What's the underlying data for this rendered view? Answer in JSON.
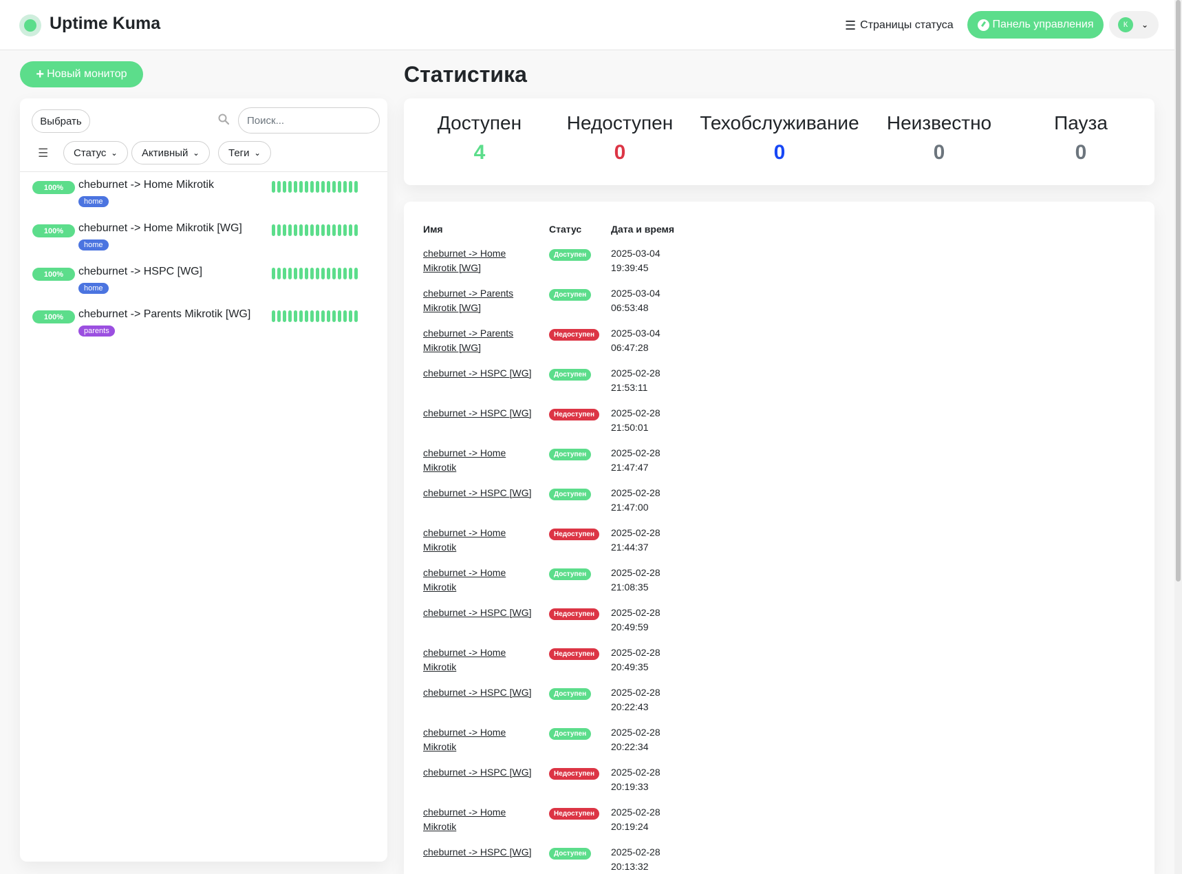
{
  "header": {
    "brand": "Uptime Kuma",
    "status_pages_label": "Страницы статуса",
    "dashboard_label": "Панель управления",
    "user_initial": "К"
  },
  "sidebar": {
    "new_monitor_label": "Новый монитор",
    "select_label": "Выбрать",
    "search_placeholder": "Поиск...",
    "filters": [
      "Статус",
      "Активный",
      "Теги"
    ],
    "monitors": [
      {
        "uptime": "100%",
        "name": "cheburnet -> Home Mikrotik",
        "tag": "home",
        "tag_color": "#4b74e0"
      },
      {
        "uptime": "100%",
        "name": "cheburnet -> Home Mikrotik [WG]",
        "tag": "home",
        "tag_color": "#4b74e0"
      },
      {
        "uptime": "100%",
        "name": "cheburnet -> HSPC [WG]",
        "tag": "home",
        "tag_color": "#4b74e0"
      },
      {
        "uptime": "100%",
        "name": "cheburnet -> Parents Mikrotik [WG]",
        "tag": "parents",
        "tag_color": "#9b4fe0"
      }
    ]
  },
  "main": {
    "title": "Статистика",
    "stats": [
      {
        "label": "Доступен",
        "value": "4",
        "color": "#5cdd8b"
      },
      {
        "label": "Недоступен",
        "value": "0",
        "color": "#dc3545"
      },
      {
        "label": "Техобслуживание",
        "value": "0",
        "color": "#1747f5"
      },
      {
        "label": "Неизвестно",
        "value": "0",
        "color": "#6c757d"
      },
      {
        "label": "Пауза",
        "value": "0",
        "color": "#6c757d"
      }
    ],
    "table_headers": {
      "name": "Имя",
      "status": "Статус",
      "datetime": "Дата и время"
    },
    "events": [
      {
        "name": "cheburnet -> Home Mikrotik [WG]",
        "status": "Доступен",
        "date": "2025-03-04 19:39:45"
      },
      {
        "name": "cheburnet -> Parents Mikrotik [WG]",
        "status": "Доступен",
        "date": "2025-03-04 06:53:48"
      },
      {
        "name": "cheburnet -> Parents Mikrotik [WG]",
        "status": "Недоступен",
        "date": "2025-03-04 06:47:28"
      },
      {
        "name": "cheburnet -> HSPC [WG]",
        "status": "Доступен",
        "date": "2025-02-28 21:53:11"
      },
      {
        "name": "cheburnet -> HSPC [WG]",
        "status": "Недоступен",
        "date": "2025-02-28 21:50:01"
      },
      {
        "name": "cheburnet -> Home Mikrotik",
        "status": "Доступен",
        "date": "2025-02-28 21:47:47"
      },
      {
        "name": "cheburnet -> HSPC [WG]",
        "status": "Доступен",
        "date": "2025-02-28 21:47:00"
      },
      {
        "name": "cheburnet -> Home Mikrotik",
        "status": "Недоступен",
        "date": "2025-02-28 21:44:37"
      },
      {
        "name": "cheburnet -> Home Mikrotik",
        "status": "Доступен",
        "date": "2025-02-28 21:08:35"
      },
      {
        "name": "cheburnet -> HSPC [WG]",
        "status": "Недоступен",
        "date": "2025-02-28 20:49:59"
      },
      {
        "name": "cheburnet -> Home Mikrotik",
        "status": "Недоступен",
        "date": "2025-02-28 20:49:35"
      },
      {
        "name": "cheburnet -> HSPC [WG]",
        "status": "Доступен",
        "date": "2025-02-28 20:22:43"
      },
      {
        "name": "cheburnet -> Home Mikrotik",
        "status": "Доступен",
        "date": "2025-02-28 20:22:34"
      },
      {
        "name": "cheburnet -> HSPC [WG]",
        "status": "Недоступен",
        "date": "2025-02-28 20:19:33"
      },
      {
        "name": "cheburnet -> Home Mikrotik",
        "status": "Недоступен",
        "date": "2025-02-28 20:19:24"
      },
      {
        "name": "cheburnet -> HSPC [WG]",
        "status": "Доступен",
        "date": "2025-02-28 20:13:32"
      }
    ]
  },
  "colors": {
    "accent": "#5cdd8b",
    "down": "#dc3545"
  }
}
